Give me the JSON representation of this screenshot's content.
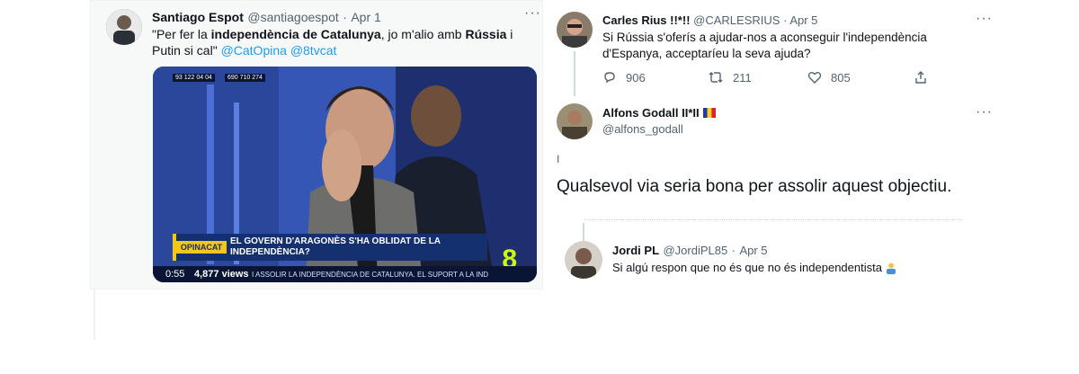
{
  "left_tweet": {
    "name": "Santiago Espot",
    "handle": "@santiagoespot",
    "separator": "·",
    "date": "Apr 1",
    "text_pre1": "\"Per fer la ",
    "text_bold1": "independència de Catalunya",
    "text_mid": ", jo m'alio amb ",
    "text_bold2": "Rússia",
    "text_mid2": " i Putin si cal\" ",
    "mention1": "@CatOpina",
    "mention2": "@8tvcat",
    "video": {
      "phone1": "93 122 04 04",
      "phone2": "690 710 274",
      "brand": "OPINACAT",
      "headline": "EL GOVERN D'ARAGONÈS S'HA OBLIDAT DE LA INDEPENDÈNCIA?",
      "duration": "0:55",
      "views": "4,877 views",
      "ticker": "I ASSOLIR LA INDEPENDÈNCIA DE CATALUNYA.   EL SUPORT A LA IND",
      "channel": "8"
    }
  },
  "tweet_carles": {
    "name": "Carles Rius !!*!!",
    "handle": "@CARLESRIUS",
    "separator": "·",
    "date": "Apr 5",
    "text": "Si Rússia s'oferís a ajudar-nos a aconseguir l'independència d'Espanya, acceptaríeu la seva ajuda?",
    "replies": "906",
    "retweets": "211",
    "likes": "805"
  },
  "tweet_alfons": {
    "name": "Alfons Godall II*II",
    "handle": "@alfons_godall",
    "cursor": "I",
    "text": "Qualsevol via seria bona per assolir aquest objectiu."
  },
  "tweet_jordi": {
    "name": "Jordi PL",
    "handle": "@JordiPL85",
    "separator": "·",
    "date": "Apr 5",
    "text": "Si algú respon que no és que no és independentista"
  },
  "colors": {
    "link": "#1d9bf0",
    "muted": "#536471"
  }
}
